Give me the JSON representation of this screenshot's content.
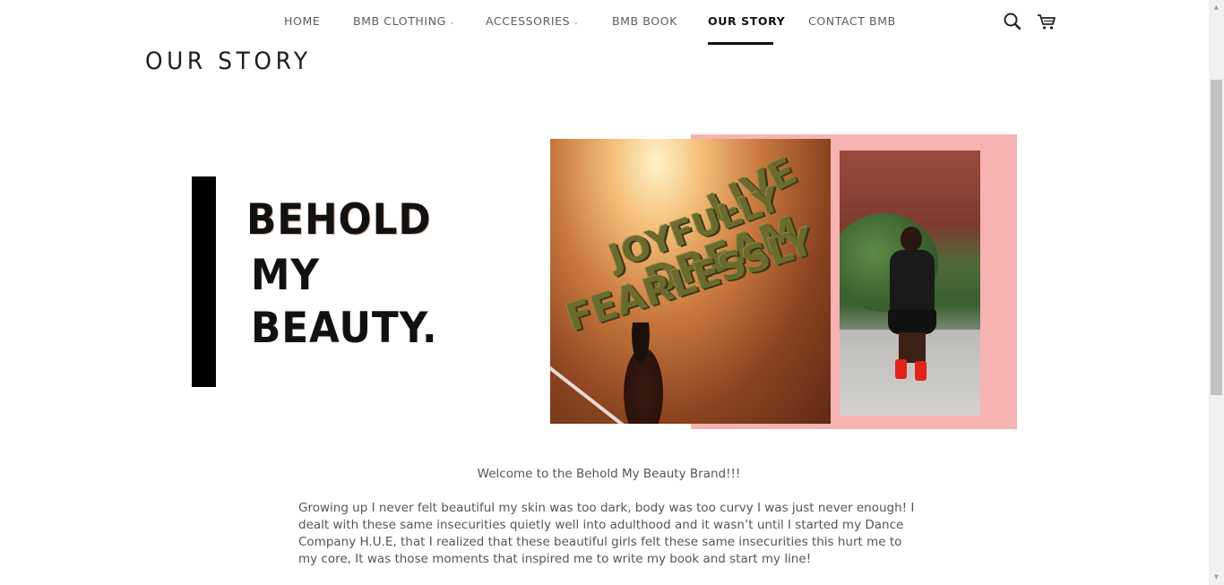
{
  "nav": {
    "items": [
      {
        "label": "HOME"
      },
      {
        "label": "BMB CLOTHING",
        "caret": "⌄"
      },
      {
        "label": "ACCESSORIES",
        "caret": "⌄"
      },
      {
        "label": "BMB BOOK"
      },
      {
        "label": "OUR STORY",
        "active": true
      },
      {
        "label": "CONTACT BMB"
      }
    ],
    "icons": [
      "search-icon",
      "cart-icon"
    ]
  },
  "page": {
    "title": "OUR STORY"
  },
  "logo": {
    "line1": "BEHOLD",
    "line2": "MY",
    "line3": "BEAUTY."
  },
  "collage": {
    "wall_text": [
      "LIVE",
      "JOYFULLY",
      "DREAM",
      "FEARLESSLY"
    ],
    "accent_color": "#f7b3b1"
  },
  "content": {
    "welcome": "Welcome to the Behold My Beauty Brand!!!",
    "story": "Growing up I never felt beautiful my skin was too dark, body was too curvy I was just never enough! I dealt with these same insecurities quietly well into adulthood and it wasn’t until I started my Dance Company H.U.E, that I realized that these beautiful girls felt these same insecurities this hurt me to my core, It was those moments that inspired me to write my book and start my line!"
  },
  "scrollbar": {
    "up_arrow": "▲",
    "down_arrow": "▼"
  }
}
